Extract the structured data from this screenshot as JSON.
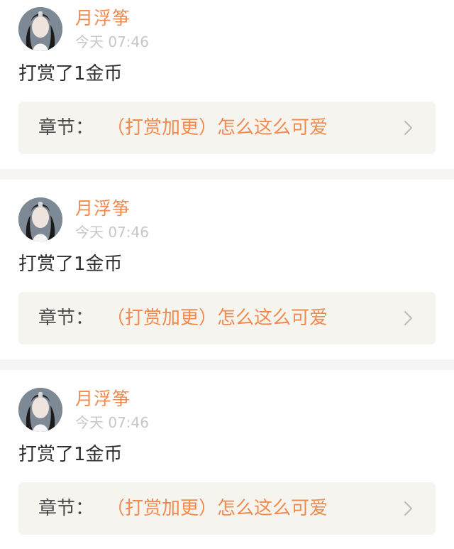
{
  "feed": {
    "items": [
      {
        "username": "月浮筝",
        "timestamp": "今天 07:46",
        "action": "打赏了1金币",
        "chapter_label": "章节：",
        "chapter_title": "（打赏加更）怎么这么可爱",
        "avatar_icon": "user-avatar"
      },
      {
        "username": "月浮筝",
        "timestamp": "今天 07:46",
        "action": "打赏了1金币",
        "chapter_label": "章节：",
        "chapter_title": "（打赏加更）怎么这么可爱",
        "avatar_icon": "user-avatar"
      },
      {
        "username": "月浮筝",
        "timestamp": "今天 07:46",
        "action": "打赏了1金币",
        "chapter_label": "章节：",
        "chapter_title": "（打赏加更）怎么这么可爱",
        "avatar_icon": "user-avatar"
      }
    ]
  },
  "colors": {
    "accent": "#f08a4f",
    "background": "#f6f5f3",
    "card": "#ffffff",
    "chapter_box": "#f5f4ef",
    "text": "#2f2f2f",
    "muted": "#c7c7c7"
  }
}
